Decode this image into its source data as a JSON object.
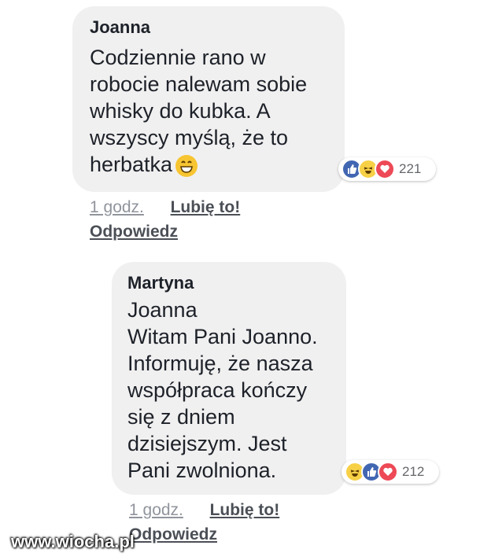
{
  "comment1": {
    "author": "Joanna",
    "text": "Codziennie rano w\nrobocie nalewam sobie\nwhisky do kubka. A\nwszyscy myślą, że to\nherbatka",
    "emoji": "grinning-face-emoji",
    "reaction_count": "221",
    "reactions": [
      "like-icon",
      "haha-icon",
      "love-icon"
    ],
    "time": "1 godz.",
    "like_label": "Lubię to!",
    "reply_label": "Odpowiedz"
  },
  "comment2": {
    "author": "Martyna",
    "mention": "Joanna",
    "text": "Witam Pani Joanno.\nInformuję, że nasza\nwspółpraca kończy\nsię z dniem\ndzisiejszym. Jest\nPani zwolniona.",
    "reaction_count": "212",
    "reactions": [
      "haha-icon",
      "like-icon",
      "love-icon"
    ],
    "time": "1 godz.",
    "like_label": "Lubię to!",
    "reply_label": "Odpowiedz"
  },
  "watermark": "www.wiocha.pl",
  "colors": {
    "bubble": "#f1f0f0",
    "like": "#4267b2",
    "love": "#ed4956",
    "haha": "#f7d046",
    "meta_text": "#90949c"
  }
}
